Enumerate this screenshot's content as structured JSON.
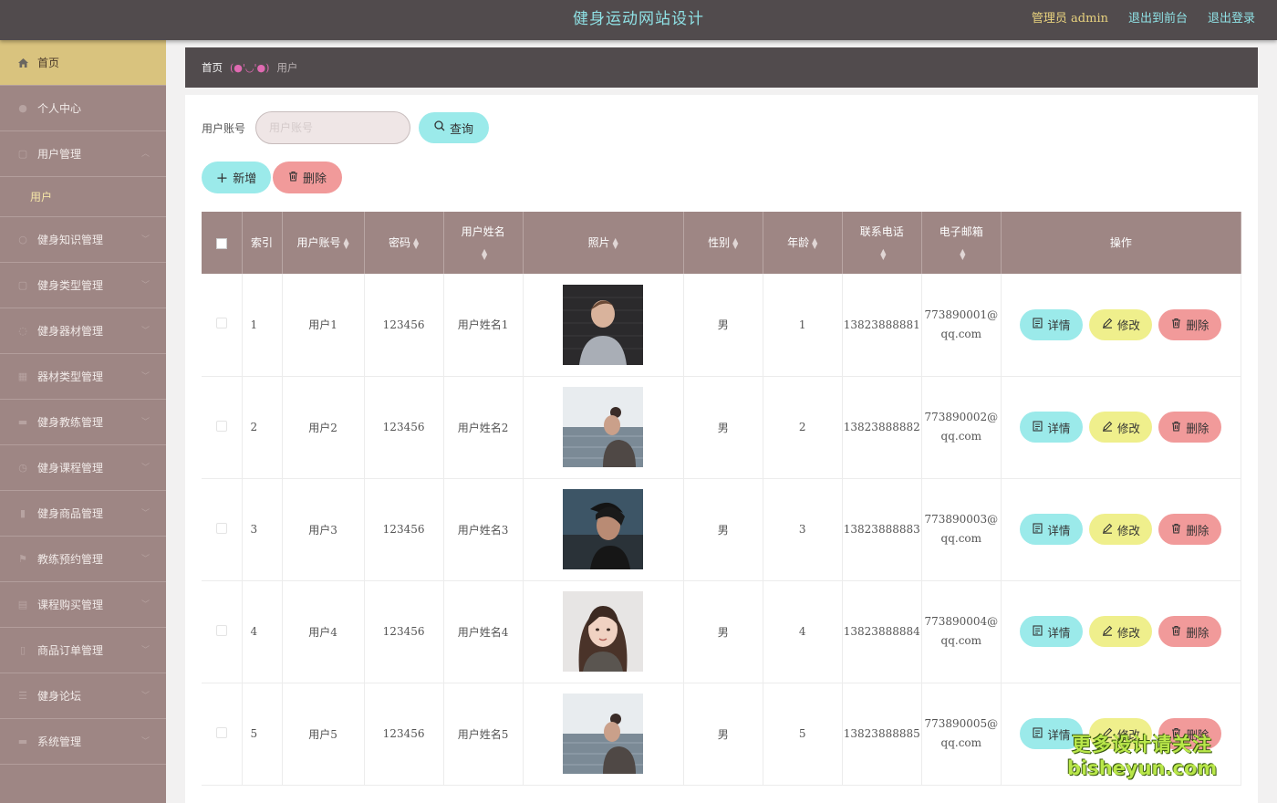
{
  "header": {
    "title": "健身运动网站设计",
    "admin": "管理员 admin",
    "to_front": "退出到前台",
    "logout": "退出登录"
  },
  "sidebar": {
    "items": [
      {
        "label": "首页",
        "icon": "home-icon",
        "active": true
      },
      {
        "label": "个人中心",
        "icon": "user-icon"
      },
      {
        "label": "用户管理",
        "icon": "users-icon",
        "expanded": true,
        "sub": [
          "用户"
        ]
      },
      {
        "label": "健身知识管理",
        "icon": "book-icon"
      },
      {
        "label": "健身类型管理",
        "icon": "tag-icon"
      },
      {
        "label": "健身器材管理",
        "icon": "gear-icon"
      },
      {
        "label": "器材类型管理",
        "icon": "grid-icon"
      },
      {
        "label": "健身教练管理",
        "icon": "coach-icon"
      },
      {
        "label": "健身课程管理",
        "icon": "clock-icon"
      },
      {
        "label": "健身商品管理",
        "icon": "chart-icon"
      },
      {
        "label": "教练预约管理",
        "icon": "flag-icon"
      },
      {
        "label": "课程购买管理",
        "icon": "cart-icon"
      },
      {
        "label": "商品订单管理",
        "icon": "order-icon"
      },
      {
        "label": "健身论坛",
        "icon": "forum-icon"
      },
      {
        "label": "系统管理",
        "icon": "system-icon"
      }
    ]
  },
  "breadcrumb": {
    "home": "首页",
    "sep": "(●'◡'●)",
    "current": "用户"
  },
  "search": {
    "label": "用户账号",
    "placeholder": "用户账号",
    "query_label": "查询"
  },
  "actions": {
    "add": "新增",
    "delete": "删除"
  },
  "table": {
    "headers": [
      "索引",
      "用户账号",
      "密码",
      "用户姓名",
      "照片",
      "性别",
      "年龄",
      "联系电话",
      "电子邮箱",
      "操作"
    ],
    "rows": [
      {
        "index": "1",
        "account": "用户1",
        "password": "123456",
        "name": "用户姓名1",
        "gender": "男",
        "age": "1",
        "phone": "13823888881",
        "email1": "773890001@",
        "email2": "qq.com"
      },
      {
        "index": "2",
        "account": "用户2",
        "password": "123456",
        "name": "用户姓名2",
        "gender": "男",
        "age": "2",
        "phone": "13823888882",
        "email1": "773890002@",
        "email2": "qq.com"
      },
      {
        "index": "3",
        "account": "用户3",
        "password": "123456",
        "name": "用户姓名3",
        "gender": "男",
        "age": "3",
        "phone": "13823888883",
        "email1": "773890003@",
        "email2": "qq.com"
      },
      {
        "index": "4",
        "account": "用户4",
        "password": "123456",
        "name": "用户姓名4",
        "gender": "男",
        "age": "4",
        "phone": "13823888884",
        "email1": "773890004@",
        "email2": "qq.com"
      },
      {
        "index": "5",
        "account": "用户5",
        "password": "123456",
        "name": "用户姓名5",
        "gender": "男",
        "age": "5",
        "phone": "13823888885",
        "email1": "773890005@",
        "email2": "qq.com"
      }
    ],
    "row_actions": {
      "detail": "详情",
      "edit": "修改",
      "delete": "删除"
    }
  },
  "watermark": {
    "line1": "更多设计请关注",
    "line2": "bisheyun.com"
  },
  "colors": {
    "header_bg": "#514b4d",
    "sidebar_bg": "#9e8684",
    "active_item": "#d9c37e",
    "cyan": "#9beaea",
    "yellow": "#efef8c",
    "pink": "#f19a9a"
  }
}
